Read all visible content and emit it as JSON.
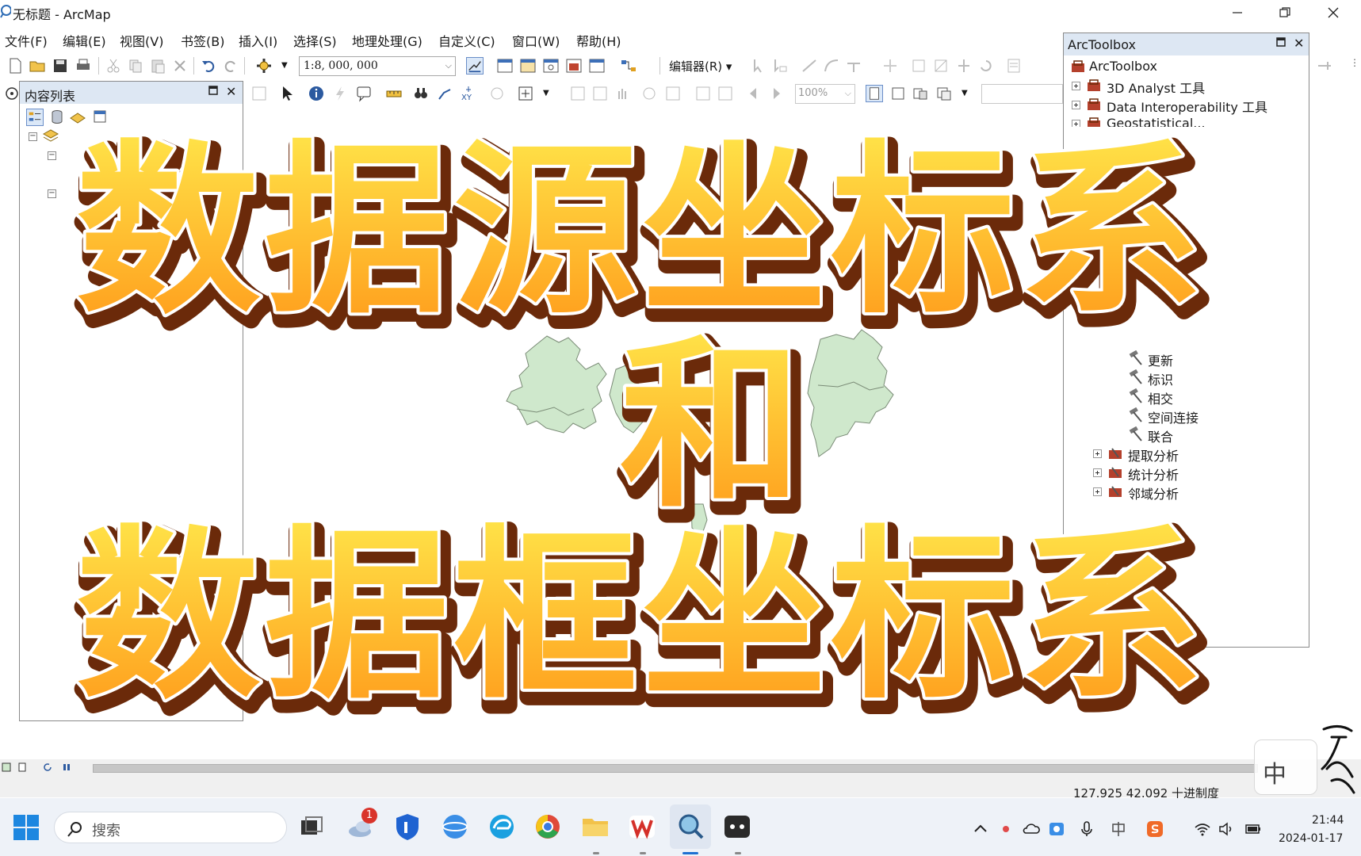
{
  "window": {
    "title": "无标题 - ArcMap"
  },
  "menu": [
    "文件(F)",
    "编辑(E)",
    "视图(V)",
    "书签(B)",
    "插入(I)",
    "选择(S)",
    "地理处理(G)",
    "自定义(C)",
    "窗口(W)",
    "帮助(H)"
  ],
  "toolbar": {
    "scale": "1:8, 000, 000",
    "editor_menu": "编辑器(R) ▾",
    "zoom": "100%"
  },
  "toc": {
    "title": "内容列表"
  },
  "arctoolbox": {
    "title": "ArcToolbox",
    "root": "ArcToolbox",
    "toolboxes_top": [
      "3D Analyst 工具",
      "Data Interoperability 工具",
      "Geostatistical..."
    ],
    "tools": [
      "更新",
      "标识",
      "相交",
      "空间连接",
      "联合"
    ],
    "toolsets": [
      "提取分析",
      "统计分析",
      "邻域分析"
    ]
  },
  "status": {
    "coords": "127.925  42.092 十进制度"
  },
  "overlay": {
    "line1": "数据源坐标系",
    "line2": "和",
    "line3": "数据框坐标系"
  },
  "watermark": {
    "seal_text": "中"
  },
  "taskbar": {
    "search_placeholder": "搜索",
    "badge_count": "1",
    "clock_time": "21:44",
    "clock_date": "2024-01-17",
    "apps": [
      "task-view",
      "weather",
      "defender",
      "browser-se",
      "edge",
      "chrome",
      "file-explorer",
      "wps",
      "arcmap",
      "screen-recorder"
    ]
  },
  "colors": {
    "overlay_fill_top": "#ffe64a",
    "overlay_fill_bottom": "#ff9a1a",
    "overlay_stroke": "#6b2a0a",
    "map_fill": "#cfe8cc",
    "panel_header": "#dde7f3",
    "toolbox_red": "#b4402c"
  }
}
